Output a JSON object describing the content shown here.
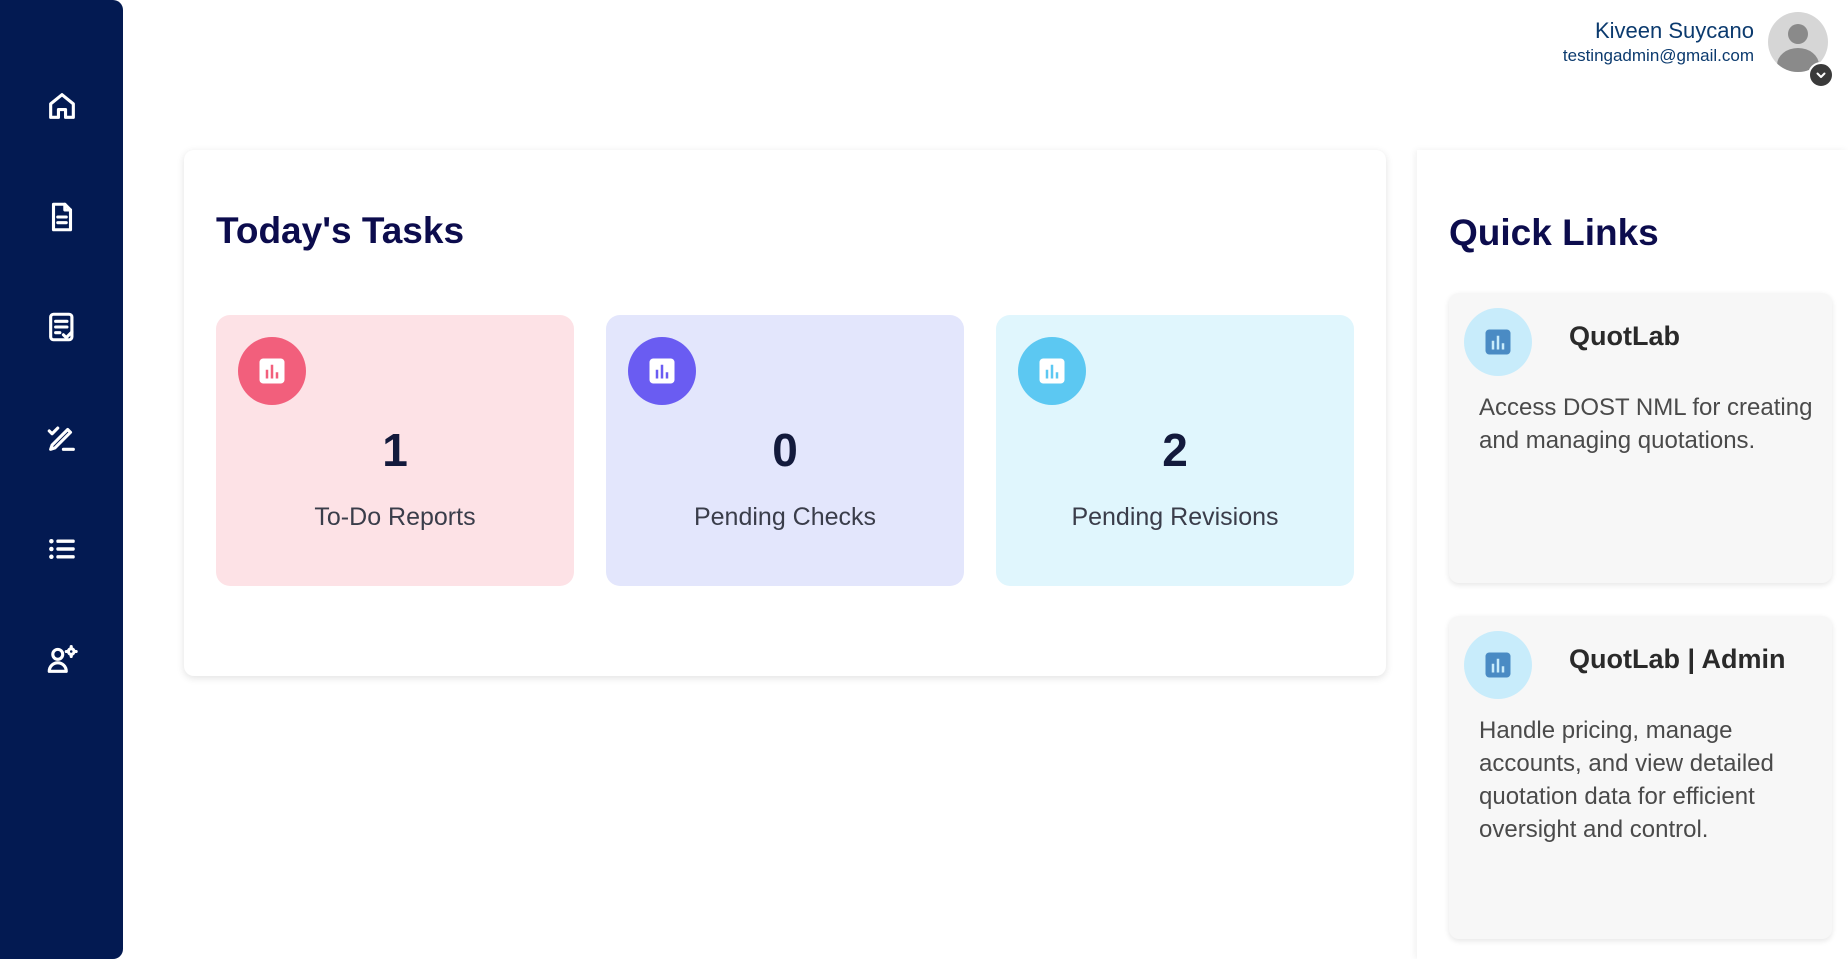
{
  "sidebar": {
    "items": [
      {
        "icon": "home-icon"
      },
      {
        "icon": "document-icon"
      },
      {
        "icon": "checklist-icon"
      },
      {
        "icon": "edit-check-icon"
      },
      {
        "icon": "list-icon"
      },
      {
        "icon": "user-settings-icon"
      }
    ]
  },
  "user": {
    "name": "Kiveen Suycano",
    "email": "testingadmin@gmail.com"
  },
  "tasks": {
    "title": "Today's Tasks",
    "cards": [
      {
        "count": "1",
        "label": "To-Do Reports",
        "icon": "chart-icon",
        "bg": "#fde2e6",
        "icon_bg": "#f25f7c"
      },
      {
        "count": "0",
        "label": "Pending Checks",
        "icon": "chart-icon",
        "bg": "#e3e6fc",
        "icon_bg": "#6a5cf2"
      },
      {
        "count": "2",
        "label": "Pending Revisions",
        "icon": "chart-icon",
        "bg": "#e0f6fd",
        "icon_bg": "#5cc8f2"
      }
    ]
  },
  "quick_links": {
    "title": "Quick Links",
    "items": [
      {
        "name": "QuotLab",
        "description": "Access DOST NML for creating and managing quotations.",
        "icon": "chart-icon"
      },
      {
        "name": "QuotLab | Admin",
        "description": "Handle pricing, manage accounts, and view detailed quotation data for efficient oversight and control.",
        "icon": "chart-icon"
      }
    ]
  },
  "colors": {
    "sidebar": "#031a52",
    "heading": "#0c0c4d",
    "quick_icon_fg": "#4a8bc4"
  }
}
